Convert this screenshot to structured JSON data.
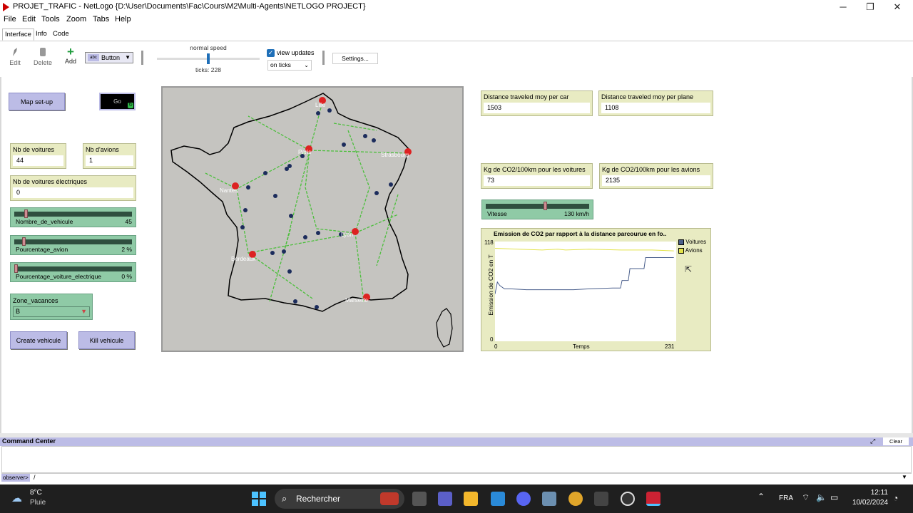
{
  "window": {
    "title": "PROJET_TRAFIC - NetLogo {D:\\User\\Documents\\Fac\\Cours\\M2\\Multi-Agents\\NETLOGO PROJECT}",
    "minimize": "─",
    "maximize": "❐",
    "close": "✕"
  },
  "menu": [
    "File",
    "Edit",
    "Tools",
    "Zoom",
    "Tabs",
    "Help"
  ],
  "tabs": [
    "Interface",
    "Info",
    "Code"
  ],
  "toolbar": {
    "edit": "Edit",
    "delete": "Delete",
    "add": "Add",
    "widget_type": "Button",
    "speed_label": "normal speed",
    "speed_fraction": 0.5,
    "ticks": "ticks: 228",
    "view_updates": "view updates",
    "view_updates_checked": true,
    "update_mode": "on ticks",
    "settings": "Settings..."
  },
  "interface": {
    "map_setup": "Map set-up",
    "go": "Go",
    "nb_voitures": {
      "label": "Nb de voitures",
      "value": "44"
    },
    "nb_avions": {
      "label": "Nb d'avions",
      "value": "1"
    },
    "nb_voitures_elec": {
      "label": "Nb de voitures électriques",
      "value": "0"
    },
    "slider_nombre": {
      "label": "Nombre_de_vehicule",
      "value": "45",
      "fraction": 0.09
    },
    "slider_avion": {
      "label": "Pourcentage_avion",
      "value": "2 %",
      "fraction": 0.07
    },
    "slider_elec": {
      "label": "Pourcentage_voiture_electrique",
      "value": "0 %",
      "fraction": 0.0
    },
    "chooser": {
      "label": "Zone_vacances",
      "value": "B"
    },
    "create_vehicule": "Create vehicule",
    "kill_vehicule": "Kill vehicule",
    "dist_car": {
      "label": "Distance traveled moy per car",
      "value": "1503"
    },
    "dist_plane": {
      "label": "Distance traveled moy per plane",
      "value": "1108"
    },
    "co2_car": {
      "label": "Kg de CO2/100km pour les voitures",
      "value": "73"
    },
    "co2_plane": {
      "label": "Kg de CO2/100km pour les avions",
      "value": "2135"
    },
    "slider_vitesse": {
      "label": "Vitesse",
      "value": "130 km/h",
      "fraction": 0.58
    },
    "cities": [
      "Lille",
      "Paris",
      "Strasbourg",
      "Nantes",
      "Lyon",
      "Bordeaux",
      "Marseille"
    ]
  },
  "chart_data": {
    "type": "line",
    "title": "Emission de CO2 par rapport à la distance parcourue en fo..",
    "xlabel": "Temps",
    "ylabel": "Emission de CO2 en T",
    "xlim": [
      0,
      231
    ],
    "ylim": [
      0,
      118
    ],
    "x_min_label": "0",
    "x_max_label": "231",
    "y_min_label": "0",
    "y_max_label": "118",
    "series": [
      {
        "name": "Voitures",
        "color": "#4a5f8c",
        "points": [
          [
            0,
            56
          ],
          [
            3,
            70
          ],
          [
            6,
            66
          ],
          [
            12,
            62
          ],
          [
            20,
            62
          ],
          [
            40,
            61
          ],
          [
            60,
            61
          ],
          [
            80,
            61
          ],
          [
            100,
            61
          ],
          [
            120,
            62
          ],
          [
            150,
            63
          ],
          [
            160,
            63
          ],
          [
            162,
            72
          ],
          [
            170,
            72
          ],
          [
            172,
            86
          ],
          [
            190,
            86
          ],
          [
            192,
            99
          ],
          [
            228,
            99
          ]
        ]
      },
      {
        "name": "Avions",
        "color": "#e3e34a",
        "points": [
          [
            0,
            110
          ],
          [
            30,
            109
          ],
          [
            60,
            108
          ],
          [
            80,
            109
          ],
          [
            90,
            108
          ],
          [
            120,
            109
          ],
          [
            160,
            108
          ],
          [
            200,
            108
          ],
          [
            228,
            107
          ]
        ]
      }
    ]
  },
  "command_center": {
    "title": "Command Center",
    "clear": "Clear",
    "prompt": "observer>",
    "input": "/"
  },
  "taskbar": {
    "temperature": "8°C",
    "weather": "Pluie",
    "search": "Rechercher",
    "lang": "FRA",
    "time": "12:11",
    "date": "10/02/2024"
  }
}
